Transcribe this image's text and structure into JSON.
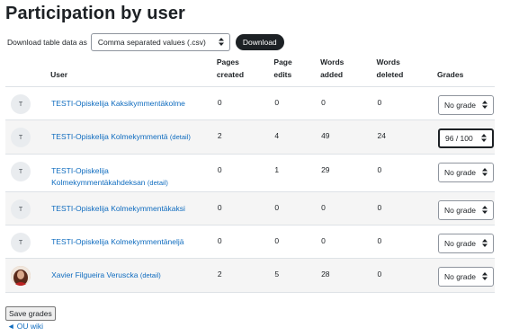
{
  "page": {
    "title": "Participation by user"
  },
  "download": {
    "label": "Download table data as",
    "format": "Comma separated values (.csv)",
    "button": "Download"
  },
  "table": {
    "headers": {
      "user": "User",
      "pages_created": [
        "Pages",
        "created"
      ],
      "page_edits": [
        "Page",
        "edits"
      ],
      "words_added": [
        "Words",
        "added"
      ],
      "words_deleted": [
        "Words",
        "deleted"
      ],
      "grades": "Grades"
    },
    "rows": [
      {
        "avatar": "T",
        "user_lines": [
          "TESTI-Opiskelija Kaksikymmentäkolme"
        ],
        "detail": "",
        "pages_created": "0",
        "page_edits": "0",
        "words_added": "0",
        "words_deleted": "0",
        "grade": "No grade"
      },
      {
        "avatar": "T",
        "user_lines": [
          "TESTI-Opiskelija Kolmekymmentä"
        ],
        "detail": "(detail)",
        "pages_created": "2",
        "page_edits": "4",
        "words_added": "49",
        "words_deleted": "24",
        "grade": "96 / 100"
      },
      {
        "avatar": "T",
        "user_lines": [
          "TESTI-Opiskelija",
          "Kolmekymmentäkahdeksan"
        ],
        "detail": "(detail)",
        "pages_created": "0",
        "page_edits": "1",
        "words_added": "29",
        "words_deleted": "0",
        "grade": "No grade"
      },
      {
        "avatar": "T",
        "user_lines": [
          "TESTI-Opiskelija Kolmekymmentäkaksi"
        ],
        "detail": "",
        "pages_created": "0",
        "page_edits": "0",
        "words_added": "0",
        "words_deleted": "0",
        "grade": "No grade"
      },
      {
        "avatar": "T",
        "user_lines": [
          "TESTI-Opiskelija Kolmekymmentäneljä"
        ],
        "detail": "",
        "pages_created": "0",
        "page_edits": "0",
        "words_added": "0",
        "words_deleted": "0",
        "grade": "No grade"
      },
      {
        "avatar": "photo",
        "user_lines": [
          "Xavier Filgueira Veruscka"
        ],
        "detail": "(detail)",
        "pages_created": "2",
        "page_edits": "5",
        "words_added": "28",
        "words_deleted": "0",
        "grade": "No grade"
      }
    ]
  },
  "footer": {
    "save_label": "Save grades",
    "back_link": "◄ OU wiki"
  },
  "icons": {
    "select_caret": "up-down-caret-icon"
  }
}
